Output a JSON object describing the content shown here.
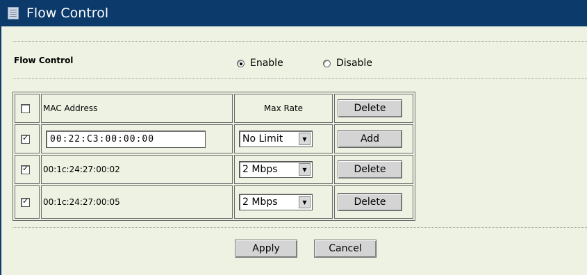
{
  "title": {
    "text": "Flow Control",
    "icon": "list-icon"
  },
  "flow_control": {
    "label": "Flow Control",
    "enable_label": "Enable",
    "disable_label": "Disable",
    "selected": "Enable"
  },
  "table": {
    "header": {
      "mac_label": "MAC Address",
      "rate_label": "Max Rate",
      "action_label": "Delete",
      "checked": false
    },
    "rows": [
      {
        "checked": true,
        "mac": "00:22:C3:00:00:00",
        "editable": true,
        "rate": "No Limit",
        "action": "Add"
      },
      {
        "checked": true,
        "mac": "00:1c:24:27:00:02",
        "editable": false,
        "rate": "2 Mbps",
        "action": "Delete"
      },
      {
        "checked": true,
        "mac": "00:1c:24:27:00:05",
        "editable": false,
        "rate": "2 Mbps",
        "action": "Delete"
      }
    ]
  },
  "buttons": {
    "apply": "Apply",
    "cancel": "Cancel"
  },
  "colors": {
    "title_bar": "#0b3a6b",
    "background": "#eef2e2",
    "button": "#d4d4d4"
  }
}
